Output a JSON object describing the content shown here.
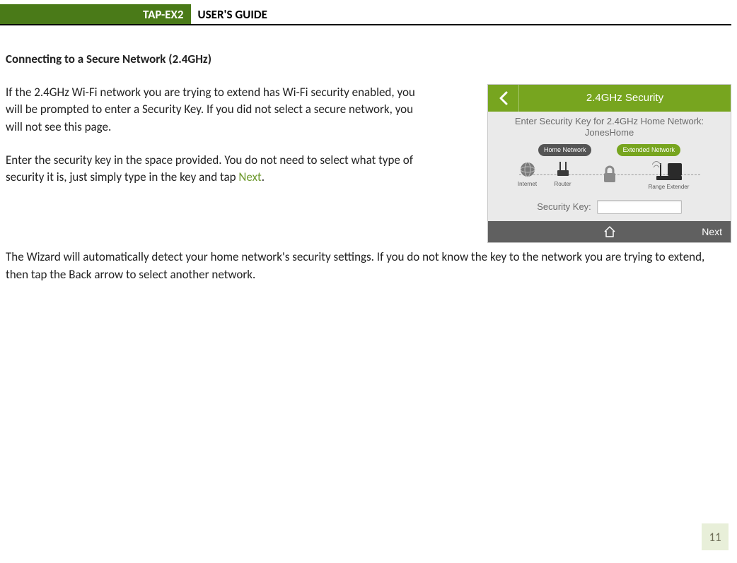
{
  "header": {
    "product": "TAP-EX2",
    "title": "USER'S GUIDE"
  },
  "section": {
    "heading": "Connecting to a Secure Network (2.4GHz)",
    "para1": "If the 2.4GHz Wi-Fi network you are trying to extend has Wi-Fi security enabled, you will be prompted to enter a Security Key. If you did not select a secure network, you will not see this page.",
    "para2_pre": "Enter the security key in the space provided. You do not need to select what type of security it is, just simply type in the key and tap ",
    "para2_next": "Next",
    "para2_post": ".",
    "para3": "The Wizard will automatically detect your home network's security settings. If you do not know the key to the network you are trying to extend, then tap the Back arrow to select another network."
  },
  "screenshot": {
    "topbar_title": "2.4GHz Security",
    "prompt_line1": "Enter Security Key for 2.4GHz Home Network:",
    "prompt_line2": "JonesHome",
    "badge_home": "Home Network",
    "badge_ext": "Extended Network",
    "node_internet": "Internet",
    "node_router": "Router",
    "node_extender": "Range Extender",
    "key_label": "Security Key:",
    "key_value": "",
    "next_label": "Next"
  },
  "page_number": "11"
}
